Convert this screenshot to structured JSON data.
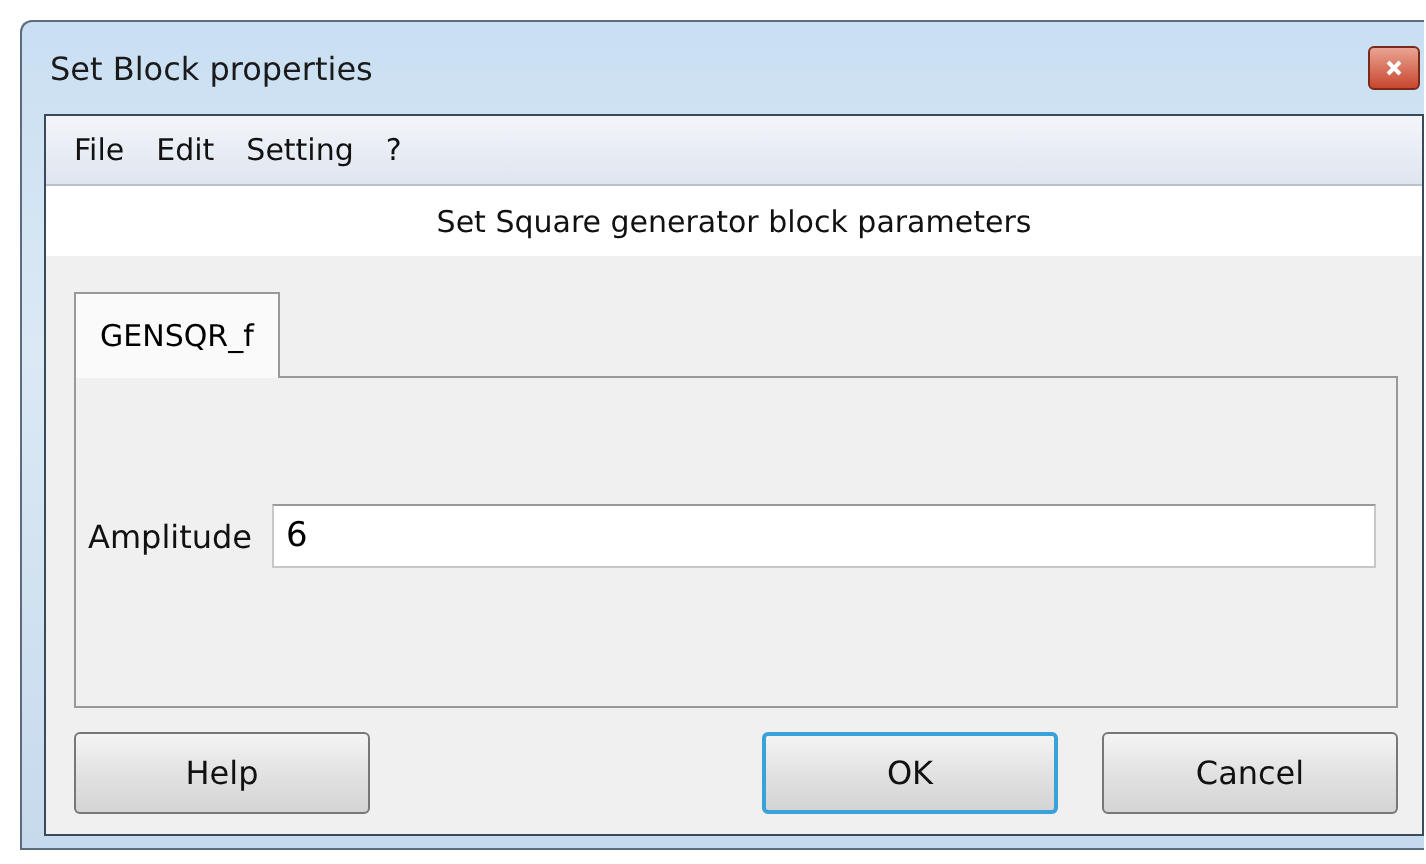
{
  "window": {
    "title": "Set Block properties"
  },
  "menu": [
    "File",
    "Edit",
    "Setting",
    "?"
  ],
  "heading": "Set Square generator block parameters",
  "tabs": [
    {
      "label": "GENSQR_f",
      "selected": true
    }
  ],
  "fields": [
    {
      "label": "Amplitude",
      "value": "6"
    }
  ],
  "buttons": [
    {
      "label": "Help",
      "default": false
    },
    {
      "label": "OK",
      "default": true
    },
    {
      "label": "Cancel",
      "default": false
    }
  ]
}
